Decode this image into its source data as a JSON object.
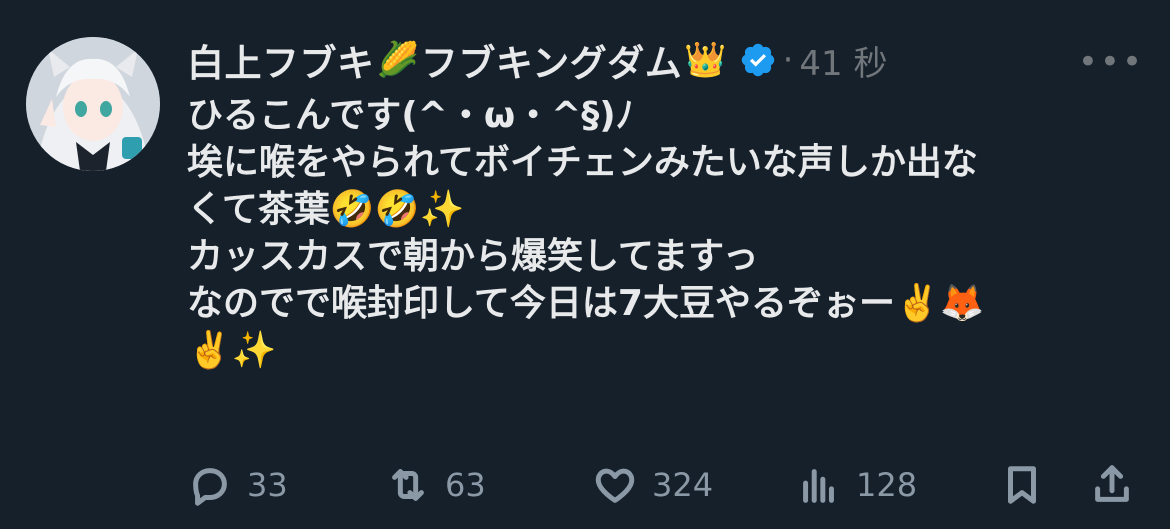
{
  "tweet": {
    "display_name": "白上フブキ",
    "emoji_corn": "🌽",
    "display_name_2": "フブキングダム",
    "emoji_crown": "👑",
    "separator": "·",
    "time": "41 秒",
    "more": "•••",
    "lines": [
      "ひるこんです(^・ω・^§)ﾉ",
      "埃に喉をやられてボイチェンみたいな声しか出な",
      "くて茶葉🤣🤣✨",
      "カッスカスで朝から爆笑してますっ",
      "なのでで喉封印して今日は7大豆やるぞぉー✌️🦊",
      "✌️✨"
    ]
  },
  "actions": {
    "reply_count": "33",
    "retweet_count": "63",
    "like_count": "324",
    "view_count": "128"
  },
  "colors": {
    "background": "#16202b",
    "text": "#e7e9ea",
    "muted": "#71767b",
    "verified": "#1d9bf0"
  },
  "icons": [
    "verified-badge-icon",
    "more-icon",
    "reply-icon",
    "retweet-icon",
    "like-icon",
    "views-icon",
    "bookmark-icon",
    "share-icon"
  ]
}
